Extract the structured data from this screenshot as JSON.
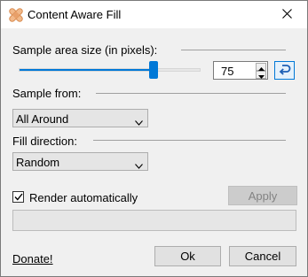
{
  "window": {
    "title": "Content Aware Fill",
    "close_icon": "close-icon",
    "app_icon": "bandage-icon",
    "accent_color": "#0078d7"
  },
  "sample_area": {
    "label": "Sample area size (in pixels):",
    "slider_fraction": 0.74,
    "value": "75",
    "reset_icon": "undo-icon"
  },
  "sample_from": {
    "label": "Sample from:",
    "selected": "All Around"
  },
  "fill_direction": {
    "label": "Fill direction:",
    "selected": "Random"
  },
  "render": {
    "checkbox_label": "Render automatically",
    "checked": true,
    "apply_label": "Apply",
    "progress_fraction": 0
  },
  "footer": {
    "donate_label": "Donate!",
    "ok_label": "Ok",
    "cancel_label": "Cancel"
  }
}
